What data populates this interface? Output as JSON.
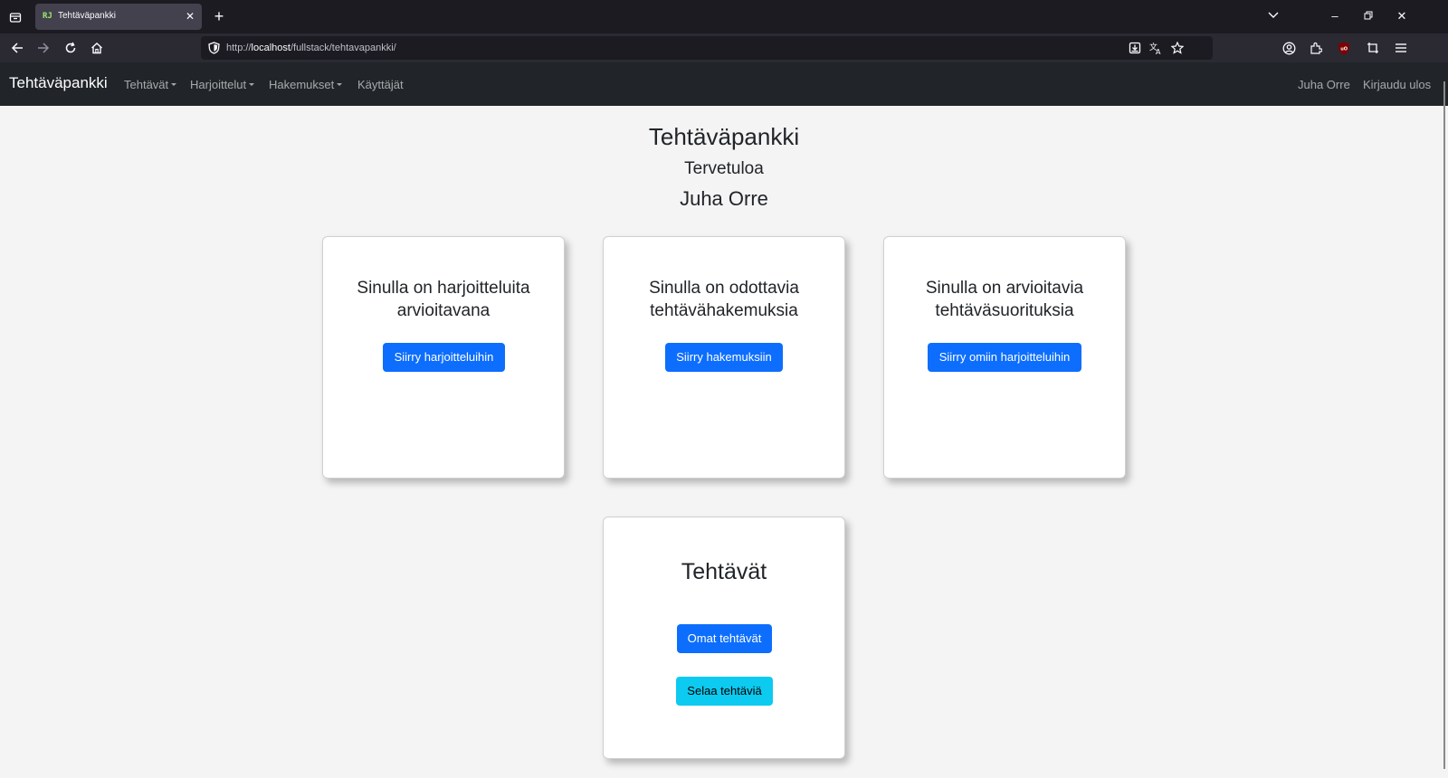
{
  "browser": {
    "tab_title": "Tehtäväpankki",
    "tab_favicon": "RJ",
    "url_prefix": "http://",
    "url_host": "localhost",
    "url_path": "/fullstack/tehtavapankki/"
  },
  "navbar": {
    "brand": "Tehtäväpankki",
    "items": [
      {
        "label": "Tehtävät",
        "dropdown": true
      },
      {
        "label": "Harjoittelut",
        "dropdown": true
      },
      {
        "label": "Hakemukset",
        "dropdown": true
      },
      {
        "label": "Käyttäjät",
        "dropdown": false
      }
    ],
    "user": "Juha Orre",
    "logout": "Kirjaudu ulos"
  },
  "page": {
    "title": "Tehtäväpankki",
    "welcome": "Tervetuloa",
    "user_name": "Juha Orre"
  },
  "cards": [
    {
      "title": "Sinulla on harjoitteluita arvioitavana",
      "button": "Siirry harjoitteluihin"
    },
    {
      "title": "Sinulla on odottavia tehtävähakemuksia",
      "button": "Siirry hakemuksiin"
    },
    {
      "title": "Sinulla on arvioitavia tehtäväsuorituksia",
      "button": "Siirry omiin harjoitteluihin"
    }
  ],
  "tasks_card": {
    "title": "Tehtävät",
    "own_button": "Omat tehtävät",
    "browse_button": "Selaa tehtäviä"
  },
  "colors": {
    "navbar_bg": "#212529",
    "primary": "#0d6efd",
    "info": "#0dcaf0",
    "page_bg": "#f4f4f4"
  }
}
